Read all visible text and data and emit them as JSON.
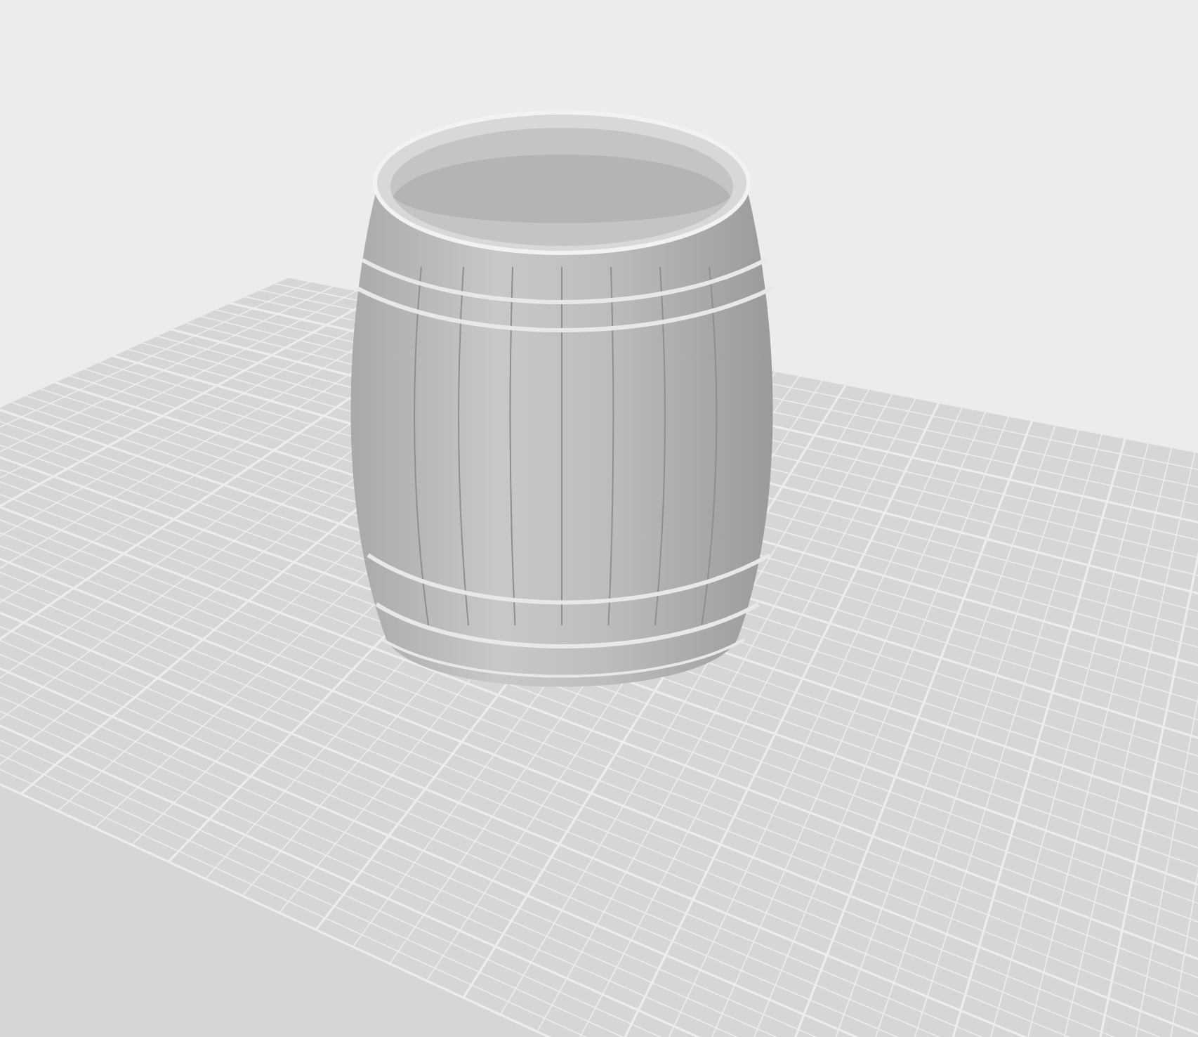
{
  "build_plate": {
    "grid_visible": true
  }
}
